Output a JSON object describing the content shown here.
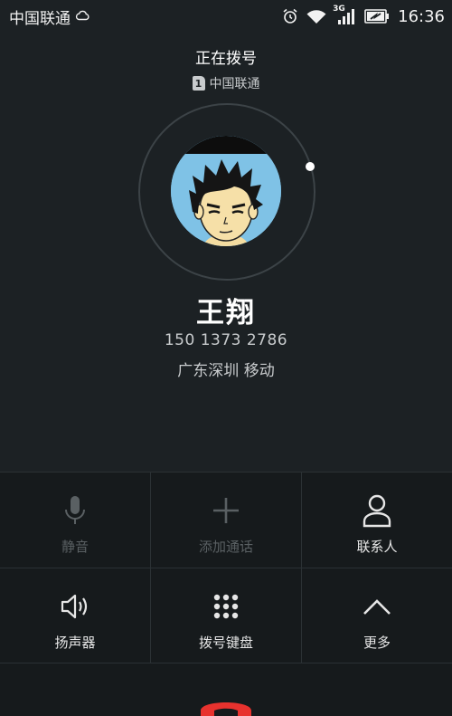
{
  "status_bar": {
    "carrier": "中国联通",
    "network_type": "3G",
    "time": "16:36"
  },
  "call": {
    "state": "正在拨号",
    "sim_slot": "1",
    "sim_carrier": "中国联通"
  },
  "contact": {
    "name": "王翔",
    "number": "150 1373 2786",
    "location": "广东深圳 移动"
  },
  "controls": [
    {
      "id": "mute",
      "label": "静音",
      "icon": "microphone-icon",
      "enabled": false
    },
    {
      "id": "add_call",
      "label": "添加通话",
      "icon": "plus-icon",
      "enabled": false
    },
    {
      "id": "contacts",
      "label": "联系人",
      "icon": "person-icon",
      "enabled": true
    },
    {
      "id": "speaker",
      "label": "扬声器",
      "icon": "speaker-icon",
      "enabled": true
    },
    {
      "id": "keypad",
      "label": "拨号键盘",
      "icon": "dialpad-icon",
      "enabled": true
    },
    {
      "id": "more",
      "label": "更多",
      "icon": "chevron-up-icon",
      "enabled": true
    }
  ],
  "colors": {
    "background": "#1c2124",
    "panel": "#161a1c",
    "end_call": "#e8322e",
    "disabled": "#5a6063"
  }
}
